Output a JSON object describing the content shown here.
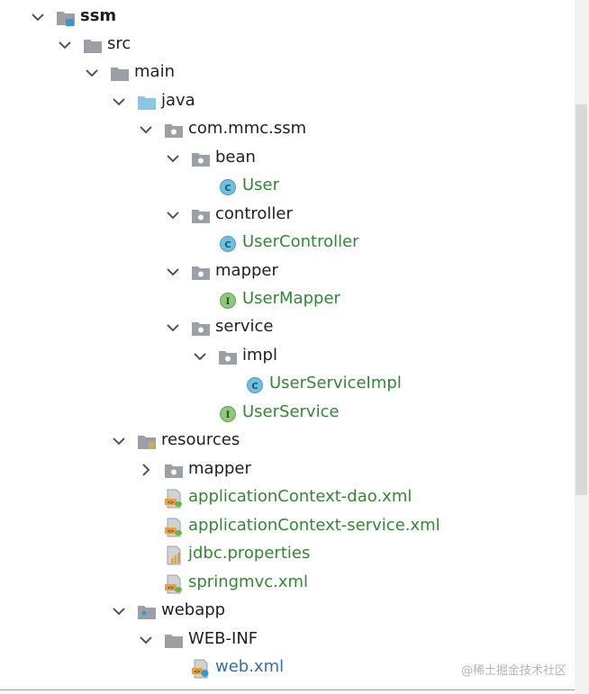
{
  "tree": {
    "rows": [
      {
        "label": "ssm",
        "arrow": "down",
        "icon": "module-folder-icon"
      },
      {
        "label": "src",
        "arrow": "down",
        "icon": "folder-icon"
      },
      {
        "label": "main",
        "arrow": "down",
        "icon": "folder-icon"
      },
      {
        "label": "java",
        "arrow": "down",
        "icon": "source-root-folder-icon"
      },
      {
        "label": "com.mmc.ssm",
        "arrow": "down",
        "icon": "package-icon"
      },
      {
        "label": "bean",
        "arrow": "down",
        "icon": "package-icon"
      },
      {
        "label": "User",
        "arrow": "none",
        "icon": "class-icon"
      },
      {
        "label": "controller",
        "arrow": "down",
        "icon": "package-icon"
      },
      {
        "label": "UserController",
        "arrow": "none",
        "icon": "class-icon"
      },
      {
        "label": "mapper",
        "arrow": "down",
        "icon": "package-icon"
      },
      {
        "label": "UserMapper",
        "arrow": "none",
        "icon": "interface-icon"
      },
      {
        "label": "service",
        "arrow": "down",
        "icon": "package-icon"
      },
      {
        "label": "impl",
        "arrow": "down",
        "icon": "package-icon"
      },
      {
        "label": "UserServiceImpl",
        "arrow": "none",
        "icon": "class-icon"
      },
      {
        "label": "UserService",
        "arrow": "none",
        "icon": "interface-icon"
      },
      {
        "label": "resources",
        "arrow": "down",
        "icon": "resources-folder-icon"
      },
      {
        "label": "mapper",
        "arrow": "right",
        "icon": "package-icon"
      },
      {
        "label": "applicationContext-dao.xml",
        "arrow": "none",
        "icon": "spring-xml-icon"
      },
      {
        "label": "applicationContext-service.xml",
        "arrow": "none",
        "icon": "spring-xml-icon"
      },
      {
        "label": "jdbc.properties",
        "arrow": "none",
        "icon": "properties-file-icon"
      },
      {
        "label": "springmvc.xml",
        "arrow": "none",
        "icon": "spring-xml-icon"
      },
      {
        "label": "webapp",
        "arrow": "down",
        "icon": "web-folder-icon"
      },
      {
        "label": "WEB-INF",
        "arrow": "down",
        "icon": "folder-icon"
      },
      {
        "label": "web.xml",
        "arrow": "none",
        "icon": "web-xml-icon"
      }
    ]
  },
  "watermark": "@稀土掘金技术社区",
  "colors": {
    "text": "#1f1f1f",
    "file_text_green": "#2f8a2f",
    "folder_gray": "#9aa0a6",
    "source_folder_blue": "#87c7e8",
    "class_icon": "#6fbfe2",
    "interface_icon": "#8cc97a"
  }
}
